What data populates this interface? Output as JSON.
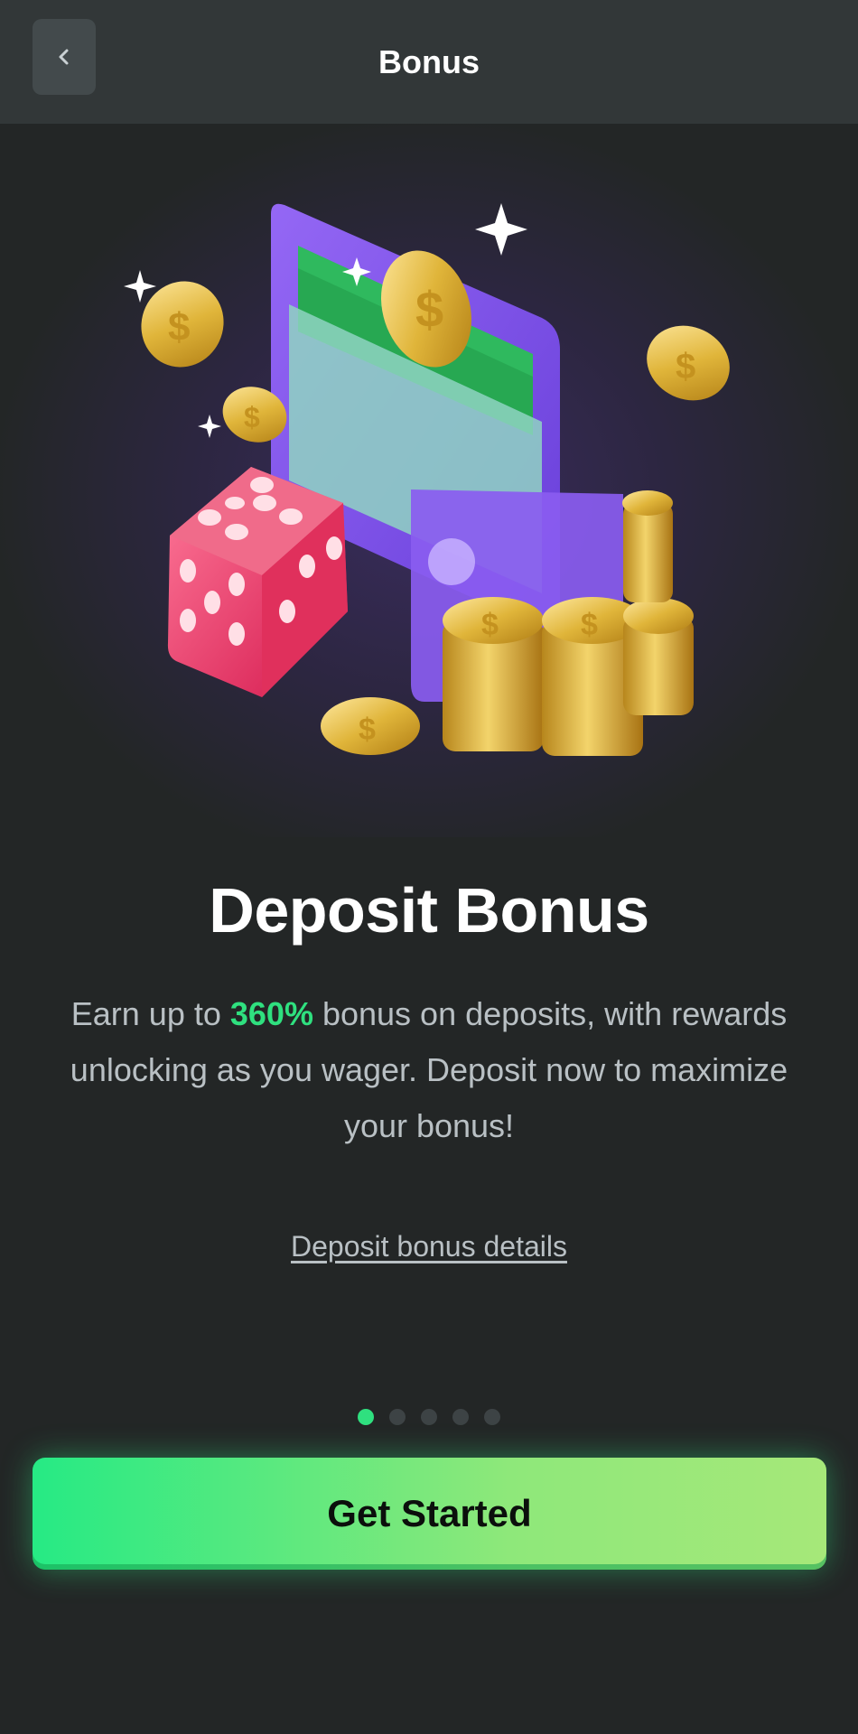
{
  "header": {
    "title": "Bonus",
    "back_icon": "chevron-left-icon"
  },
  "hero": {
    "illustration": "wallet-coins-dice-illustration"
  },
  "content": {
    "title": "Deposit Bonus",
    "description_prefix": "Earn up to ",
    "description_highlight": "360%",
    "description_suffix": " bonus on deposits, with rewards unlocking as you wager. Deposit now to maximize your bonus!",
    "details_link": "Deposit bonus details"
  },
  "pagination": {
    "total": 5,
    "active": 1
  },
  "cta": {
    "label": "Get Started"
  },
  "colors": {
    "accent": "#2fe07f",
    "background": "#232626",
    "header": "#323738"
  }
}
